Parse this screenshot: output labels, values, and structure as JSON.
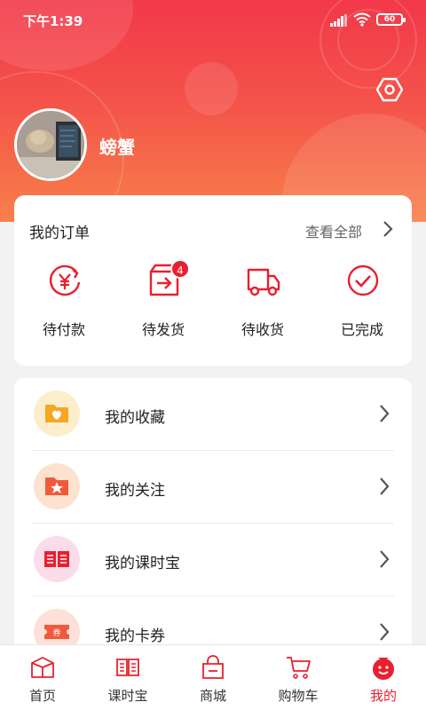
{
  "status_bar": {
    "time": "下午1:39",
    "battery": "60"
  },
  "profile": {
    "username": "螃蟹"
  },
  "orders": {
    "title": "我的订单",
    "view_all": "查看全部",
    "items": [
      {
        "label": "待付款",
        "icon": "yen-refresh-icon"
      },
      {
        "label": "待发货",
        "icon": "box-send-icon",
        "badge": "4"
      },
      {
        "label": "待收货",
        "icon": "truck-icon"
      },
      {
        "label": "已完成",
        "icon": "check-circle-icon"
      }
    ]
  },
  "menu": {
    "items": [
      {
        "label": "我的收藏",
        "icon": "favorite-folder-icon",
        "bg": "#fdeecb"
      },
      {
        "label": "我的关注",
        "icon": "star-folder-icon",
        "bg": "#fde2cf"
      },
      {
        "label": "我的课时宝",
        "icon": "book-icon",
        "bg": "#fbdcea"
      },
      {
        "label": "我的卡券",
        "icon": "coupon-icon",
        "bg": "#fde0d8"
      }
    ],
    "coupon_text": "券"
  },
  "tabbar": {
    "items": [
      {
        "label": "首页",
        "icon": "home-box-icon"
      },
      {
        "label": "课时宝",
        "icon": "book-tab-icon"
      },
      {
        "label": "商城",
        "icon": "shopping-bag-icon"
      },
      {
        "label": "购物车",
        "icon": "cart-icon"
      },
      {
        "label": "我的",
        "icon": "profile-face-icon",
        "active": true
      }
    ]
  },
  "colors": {
    "accent": "#e8202f",
    "header_top": "#f2384a",
    "header_bottom": "#f7804a"
  }
}
